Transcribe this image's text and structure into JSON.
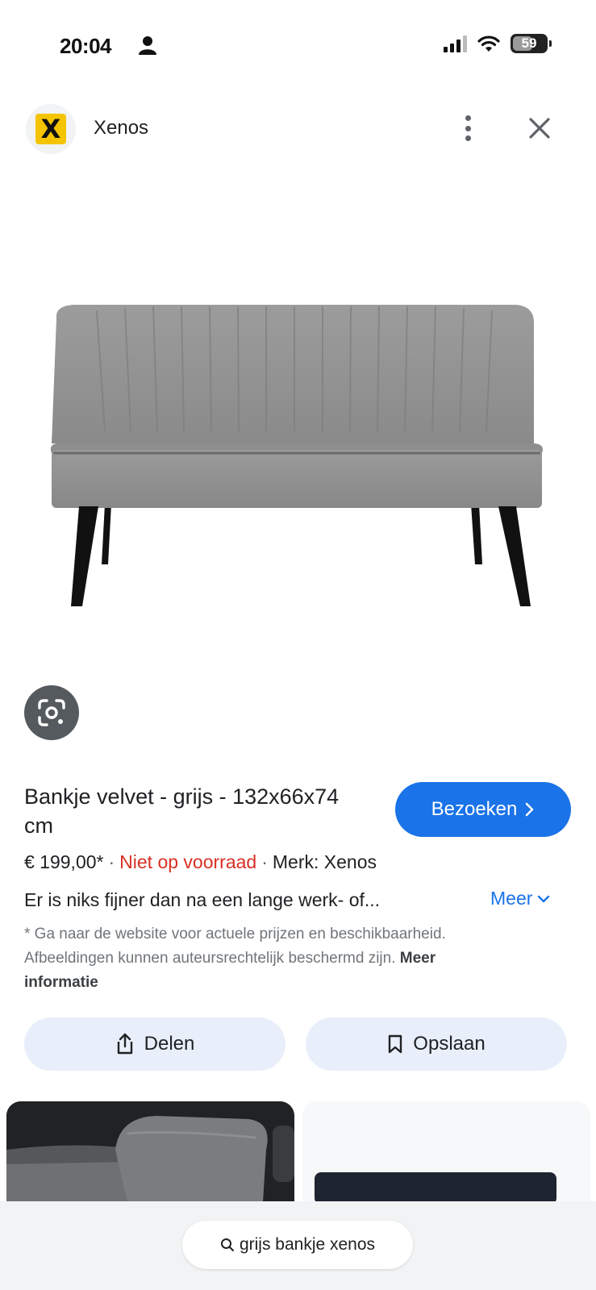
{
  "status_bar": {
    "time": "20:04",
    "battery": "59"
  },
  "header": {
    "site_name": "Xenos",
    "logo_letter": "X",
    "more_icon": "more-vert-icon",
    "close_icon": "close-icon"
  },
  "product": {
    "title": "Bankje velvet - grijs - 132x66x74 cm",
    "visit_label": "Bezoeken",
    "price": "€ 199,00*",
    "stock": "Niet op voorraad",
    "brand": "Merk: Xenos",
    "description": "Er is niks fijner dan na een lange werk- of...",
    "more_label": "Meer",
    "disclaimer": "* Ga naar de website voor actuele prijzen en beschikbaarheid. Afbeeldingen kunnen auteursrechtelijk beschermd zijn.",
    "more_info_label": "Meer informatie"
  },
  "actions": {
    "share_label": "Delen",
    "save_label": "Opslaan"
  },
  "search": {
    "query": "grijs bankje xenos"
  },
  "colors": {
    "accent_blue": "#1a73e8",
    "stock_red": "#d93025",
    "brand_yellow": "#f5c400",
    "chip_bg": "#e8effa"
  }
}
